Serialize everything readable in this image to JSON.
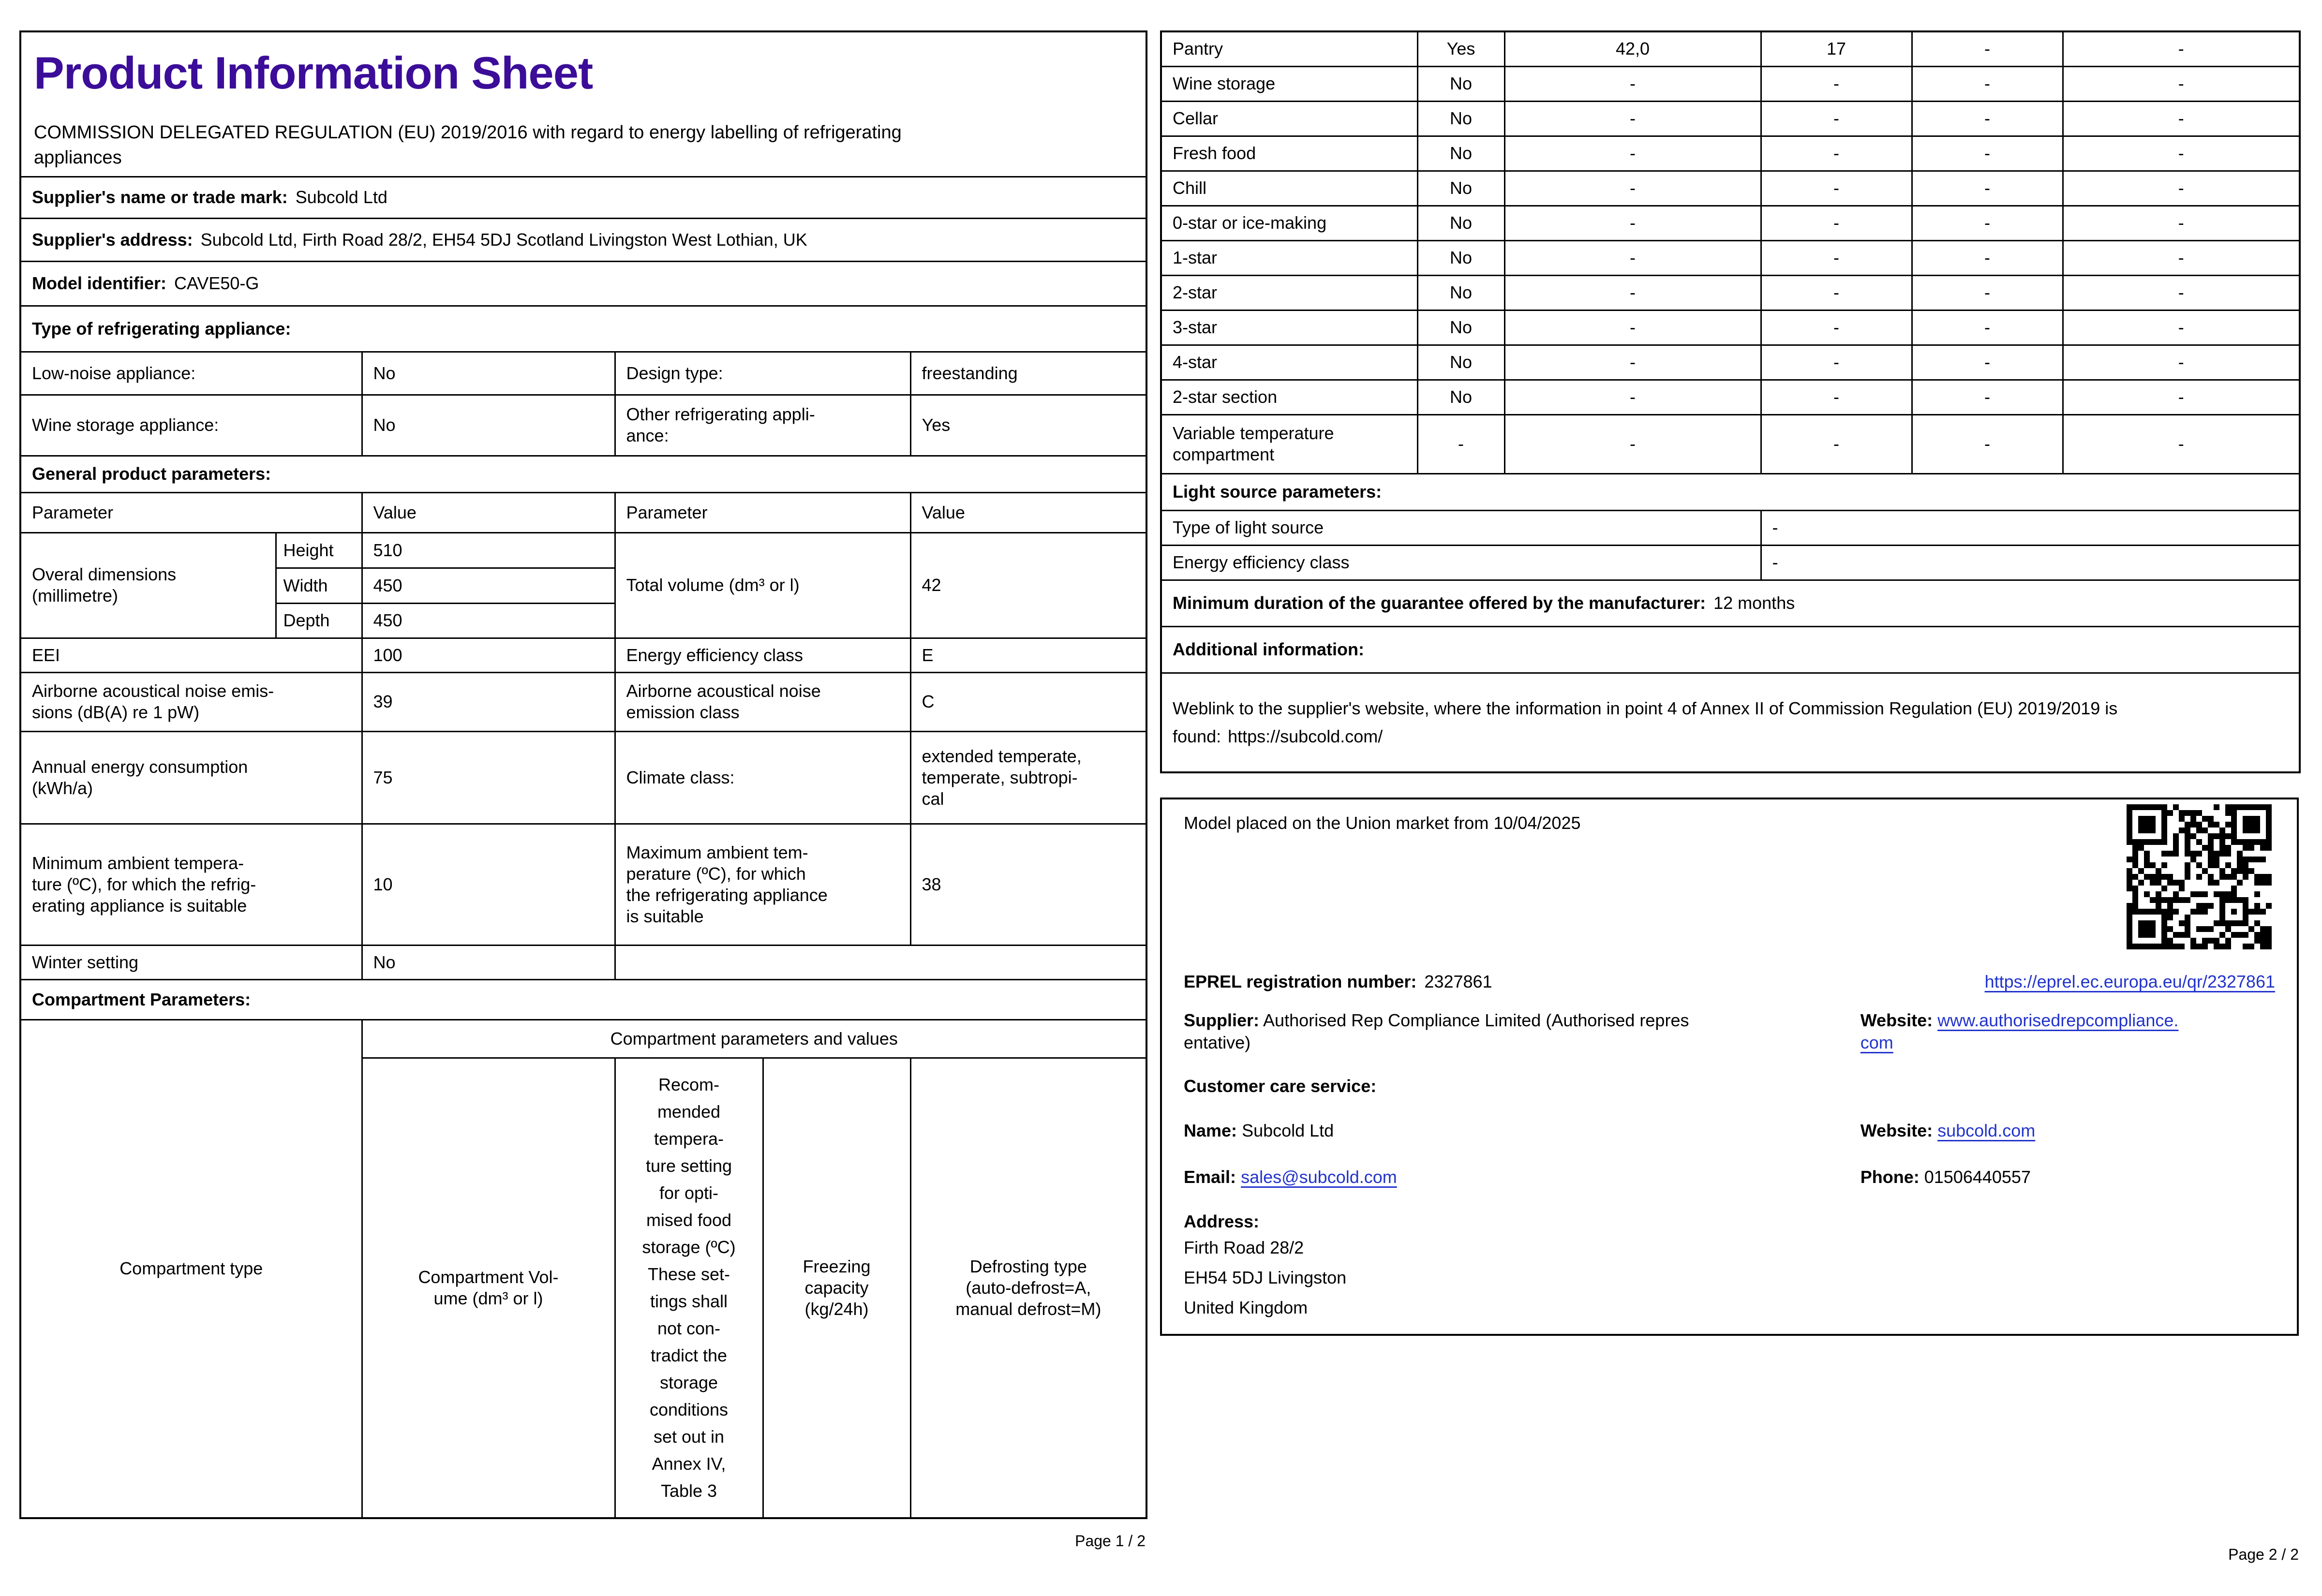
{
  "colors": {
    "title_accent": "#3B0D99",
    "link_blue": "#2233CC"
  },
  "page1": {
    "title": "Product Information Sheet",
    "regulation": "COMMISSION DELEGATED REGULATION (EU) 2019/2016 with regard to energy labelling of refrigerating\nappliances",
    "supplier_name": {
      "label": "Supplier's name or trade mark:",
      "value": "Subcold Ltd"
    },
    "supplier_address": {
      "label": "Supplier's address:",
      "value": "Subcold Ltd, Firth Road 28/2, EH54 5DJ Scotland Livingston West Lothian, UK"
    },
    "model": {
      "label": "Model identifier:",
      "value": "CAVE50-G"
    },
    "type_heading": "Type of refrigerating appliance:",
    "type_rows": [
      {
        "c1": "Low-noise appliance:",
        "c2": "No",
        "c3": "Design type:",
        "c4": "freestanding"
      },
      {
        "c1": "Wine storage appliance:",
        "c2": "No",
        "c3": "Other refrigerating appli-\nance:",
        "c4": "Yes"
      }
    ],
    "general_heading": "General product parameters:",
    "param_header": {
      "p1": "Parameter",
      "v1": "Value",
      "p2": "Parameter",
      "v2": "Value"
    },
    "dimensions": {
      "label": "Overal dimensions\n(millimetre)",
      "rows": [
        {
          "name": "Height",
          "value": "510"
        },
        {
          "name": "Width",
          "value": "450"
        },
        {
          "name": "Depth",
          "value": "450"
        }
      ],
      "volume_label": "Total volume (dm³ or l)",
      "volume_value": "42"
    },
    "param_rows": [
      {
        "c1": "EEI",
        "c2": "100",
        "c3": "Energy efficiency class",
        "c4": "E"
      },
      {
        "c1": "Airborne acoustical noise emis-\nsions (dB(A) re 1 pW)",
        "c2": "39",
        "c3": "Airborne acoustical noise\nemission class",
        "c4": "C"
      },
      {
        "c1": "Annual energy consumption\n(kWh/a)",
        "c2": "75",
        "c3": "Climate class:",
        "c4": "extended temperate,\ntemperate, subtropi-\ncal"
      },
      {
        "c1": "Minimum ambient tempera-\nture (ºC), for which the refrig-\nerating appliance is suitable",
        "c2": "10",
        "c3": "Maximum ambient tem-\nperature (ºC), for which\nthe refrigerating appliance\nis suitable",
        "c4": "38"
      }
    ],
    "winter": {
      "label": "Winter setting",
      "value": "No"
    },
    "compartment_heading": "Compartment Parameters:",
    "compartment_header": {
      "type": "Compartment type",
      "group": "Compartment parameters and values",
      "volume": "Compartment Vol-\nume (dm³ or l)",
      "temperature": "Recom-\nmended\ntempera-\nture setting\nfor opti-\nmised food\nstorage (ºC)\nThese set-\ntings shall\nnot con-\ntradict the\nstorage\nconditions\nset out in\nAnnex IV,\nTable 3",
      "freezing": "Freezing\ncapacity\n(kg/24h)",
      "defrosting": "Defrosting type\n(auto-defrost=A,\nmanual defrost=M)"
    },
    "footer": "Page 1 / 2"
  },
  "page2": {
    "compartments": [
      {
        "name": "Pantry",
        "present": "Yes",
        "volume": "42,0",
        "temp": "17",
        "freezing": "-",
        "defrosting": "-"
      },
      {
        "name": "Wine storage",
        "present": "No",
        "volume": "-",
        "temp": "-",
        "freezing": "-",
        "defrosting": "-"
      },
      {
        "name": "Cellar",
        "present": "No",
        "volume": "-",
        "temp": "-",
        "freezing": "-",
        "defrosting": "-"
      },
      {
        "name": "Fresh food",
        "present": "No",
        "volume": "-",
        "temp": "-",
        "freezing": "-",
        "defrosting": "-"
      },
      {
        "name": "Chill",
        "present": "No",
        "volume": "-",
        "temp": "-",
        "freezing": "-",
        "defrosting": "-"
      },
      {
        "name": "0-star or ice-making",
        "present": "No",
        "volume": "-",
        "temp": "-",
        "freezing": "-",
        "defrosting": "-"
      },
      {
        "name": "1-star",
        "present": "No",
        "volume": "-",
        "temp": "-",
        "freezing": "-",
        "defrosting": "-"
      },
      {
        "name": "2-star",
        "present": "No",
        "volume": "-",
        "temp": "-",
        "freezing": "-",
        "defrosting": "-"
      },
      {
        "name": "3-star",
        "present": "No",
        "volume": "-",
        "temp": "-",
        "freezing": "-",
        "defrosting": "-"
      },
      {
        "name": "4-star",
        "present": "No",
        "volume": "-",
        "temp": "-",
        "freezing": "-",
        "defrosting": "-"
      },
      {
        "name": "2-star section",
        "present": "No",
        "volume": "-",
        "temp": "-",
        "freezing": "-",
        "defrosting": "-"
      },
      {
        "name": "Variable temperature\ncompartment",
        "present": "-",
        "volume": "-",
        "temp": "-",
        "freezing": "-",
        "defrosting": "-"
      }
    ],
    "light_heading": "Light source parameters:",
    "light_rows": [
      {
        "label": "Type of light source",
        "value": "-"
      },
      {
        "label": "Energy efficiency class",
        "value": "-"
      }
    ],
    "guarantee": {
      "label": "Minimum duration of the guarantee offered by the manufacturer:",
      "value": "12 months"
    },
    "additional_heading": "Additional information:",
    "weblink": {
      "text": "Weblink to the supplier's website, where the information in point 4 of Annex II of Commission Regulation (EU) 2019/2019 is found:",
      "url": "https://subcold.com/"
    },
    "market": {
      "placed": "Model placed on the Union market from 10/04/2025",
      "eprel_label": "EPREL registration number:",
      "eprel_value": "2327861",
      "eprel_link": "https://eprel.ec.europa.eu/qr/2327861",
      "supplier_label": "Supplier:",
      "supplier_value": "Authorised Rep Compliance Limited (Authorised repres\nentative)",
      "website_label": "Website:",
      "website_value": "www.authorisedrepcompliance.\ncom",
      "care_heading": "Customer care service:",
      "name_label": "Name:",
      "name_value": "Subcold Ltd",
      "website2_label": "Website:",
      "website2_value": "subcold.com",
      "email_label": "Email:",
      "email_value": "sales@subcold.com",
      "phone_label": "Phone:",
      "phone_value": "01506440557",
      "address_label": "Address:",
      "address_lines": "Firth Road 28/2\n EH54 5DJ Livingston\nUnited Kingdom"
    },
    "footer": "Page 2 / 2"
  }
}
